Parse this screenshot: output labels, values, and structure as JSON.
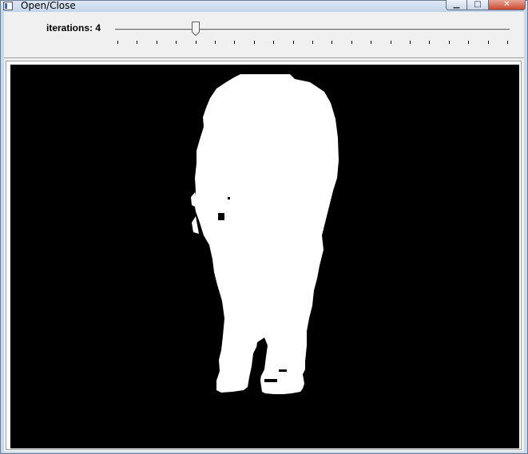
{
  "window": {
    "title": "Open/Close",
    "controls": {
      "minimize_icon": "minimize-icon",
      "maximize_icon": "maximize-icon",
      "close_icon": "close-icon",
      "minimize_glyph": "▁",
      "maximize_glyph": "□",
      "close_glyph": "✕"
    }
  },
  "trackbar": {
    "label": "iterations: 4",
    "value": 4,
    "max": 20
  },
  "image": {
    "description_icon": "binary-mask-image",
    "background_color": "#000000",
    "foreground_color": "#ffffff"
  },
  "colors": {
    "titlebar": "#c4d5ea",
    "client": "#f0f0f0",
    "close_button": "#c9482f"
  }
}
